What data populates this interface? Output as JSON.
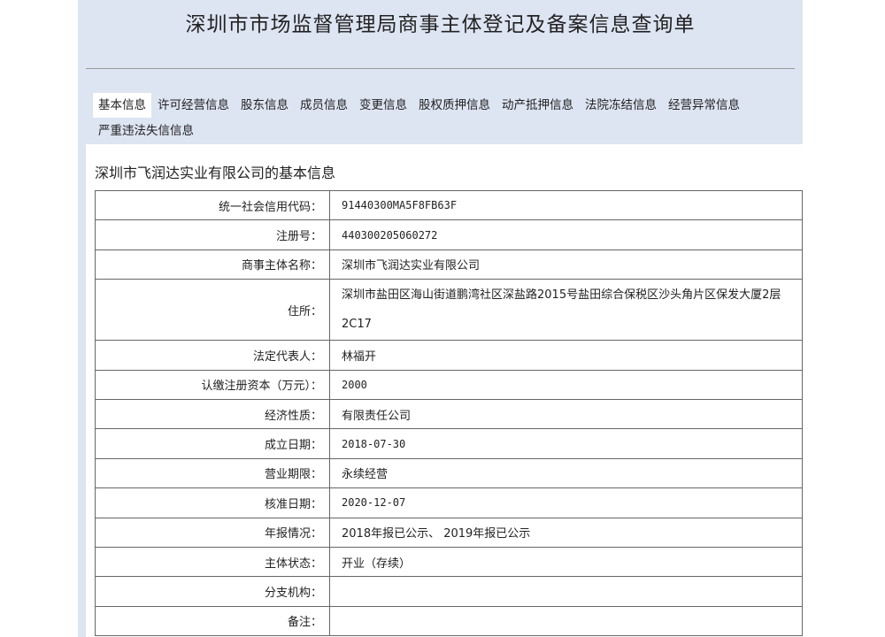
{
  "page": {
    "title": "深圳市市场监督管理局商事主体登记及备案信息查询单"
  },
  "tabs": {
    "row1": [
      {
        "label": "基本信息"
      },
      {
        "label": "许可经营信息"
      },
      {
        "label": "股东信息"
      },
      {
        "label": "成员信息"
      },
      {
        "label": "变更信息"
      },
      {
        "label": "股权质押信息"
      },
      {
        "label": "动产抵押信息"
      },
      {
        "label": "法院冻结信息"
      },
      {
        "label": "经营异常信息"
      }
    ],
    "row2": [
      {
        "label": "严重违法失信信息"
      }
    ],
    "active": "基本信息"
  },
  "section": {
    "title": "深圳市飞润达实业有限公司的基本信息"
  },
  "info": {
    "credit_code": {
      "label": "统一社会信用代码：",
      "value": "91440300MA5F8FB63F"
    },
    "reg_no": {
      "label": "注册号：",
      "value": "440300205060272"
    },
    "name": {
      "label": "商事主体名称：",
      "value": "深圳市飞润达实业有限公司"
    },
    "address": {
      "label": "住所：",
      "value": "深圳市盐田区海山街道鹏湾社区深盐路2015号盐田综合保税区沙头角片区保发大厦2层2C17"
    },
    "legal_rep": {
      "label": "法定代表人：",
      "value": "林福开"
    },
    "capital": {
      "label": "认缴注册资本（万元）：",
      "value": "2000"
    },
    "nature": {
      "label": "经济性质：",
      "value": "有限责任公司"
    },
    "founded": {
      "label": "成立日期：",
      "value": "2018-07-30"
    },
    "term": {
      "label": "营业期限：",
      "value": "永续经营"
    },
    "approved": {
      "label": "核准日期：",
      "value": "2020-12-07"
    },
    "annual_report": {
      "label": "年报情况：",
      "value": "2018年报已公示、 2019年报已公示"
    },
    "status": {
      "label": "主体状态：",
      "value": "开业（存续）"
    },
    "branch": {
      "label": "分支机构：",
      "value": ""
    },
    "remarks": {
      "label": "备注：",
      "value": ""
    }
  }
}
